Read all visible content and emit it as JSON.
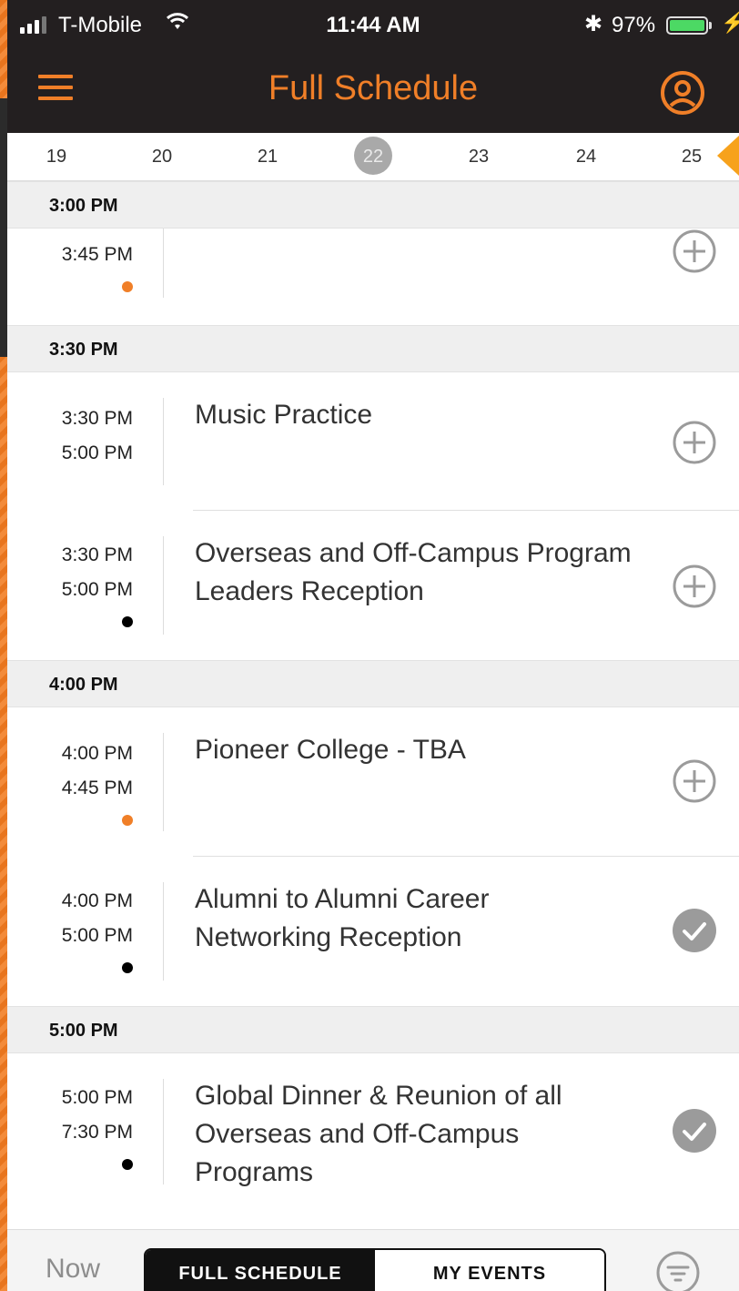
{
  "status_bar": {
    "carrier": "T-Mobile",
    "time": "11:44 AM",
    "battery_percent": "97%"
  },
  "header": {
    "title": "Full Schedule"
  },
  "dates": {
    "items": [
      "19",
      "20",
      "21",
      "22",
      "23",
      "24",
      "25"
    ],
    "selected": "22"
  },
  "schedule": {
    "sec1": {
      "heading": "3:00 PM",
      "ev1": {
        "start": "3:45 PM",
        "end": "",
        "title": "",
        "added": false,
        "dot": "orange"
      }
    },
    "sec2": {
      "heading": "3:30 PM",
      "ev1": {
        "start": "3:30 PM",
        "end": "5:00 PM",
        "title": "Music Practice",
        "added": false
      },
      "ev2": {
        "start": "3:30 PM",
        "end": "5:00 PM",
        "title": "Overseas and Off-Campus Program Leaders Reception",
        "added": false,
        "dot": "black"
      }
    },
    "sec3": {
      "heading": "4:00 PM",
      "ev1": {
        "start": "4:00 PM",
        "end": "4:45 PM",
        "title": "Pioneer College - TBA",
        "added": false,
        "dot": "orange"
      },
      "ev2": {
        "start": "4:00 PM",
        "end": "5:00 PM",
        "title": "Alumni to Alumni Career Networking Reception",
        "added": true,
        "dot": "black"
      }
    },
    "sec4": {
      "heading": "5:00 PM",
      "ev1": {
        "start": "5:00 PM",
        "end": "7:30 PM",
        "title": "Global Dinner & Reunion of all Overseas and Off-Campus Programs",
        "added": true,
        "dot": "black"
      }
    }
  },
  "bottom_bar": {
    "now_label": "Now",
    "tab_full": "FULL SCHEDULE",
    "tab_mine": "MY EVENTS",
    "active_tab": "FULL SCHEDULE"
  },
  "colors": {
    "accent": "#f07f28",
    "header_bg": "#231f20",
    "dot_orange": "#f07f28",
    "dot_black": "#000000",
    "added_gray": "#9b9b9b"
  },
  "icons": {
    "menu": "hamburger-menu-icon",
    "profile": "user-circle-icon",
    "add": "plus-circle-icon",
    "added": "check-circle-icon",
    "filter": "filter-icon"
  }
}
